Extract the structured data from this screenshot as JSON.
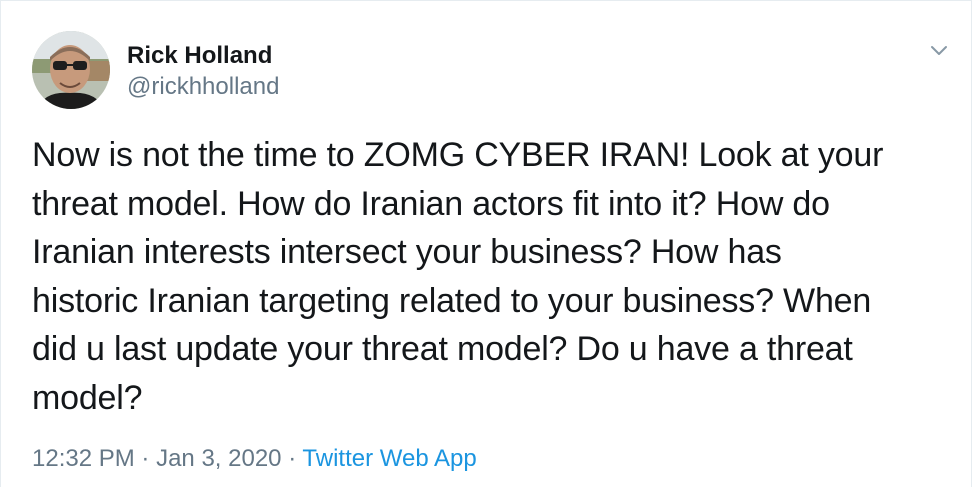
{
  "author": {
    "name": "Rick Holland",
    "handle": "@rickhholland",
    "avatar_icon": "profile-photo"
  },
  "menu_icon": "chevron-down-icon",
  "tweet": {
    "lines": [
      "Now is not the time to ZOMG CYBER IRAN! Look at your",
      "threat model. How do Iranian actors fit into it? How do",
      "Iranian interests intersect your business? How has",
      "historic Iranian targeting related to your business? When",
      "did u last update your threat model? Do u have a threat",
      "model?"
    ]
  },
  "meta": {
    "time": "12:32 PM",
    "separator": "·",
    "date": "Jan 3, 2020",
    "source": "Twitter Web App"
  },
  "colors": {
    "text": "#14171a",
    "secondary": "#657786",
    "link": "#1b95e0",
    "border": "#e6ecf0"
  }
}
